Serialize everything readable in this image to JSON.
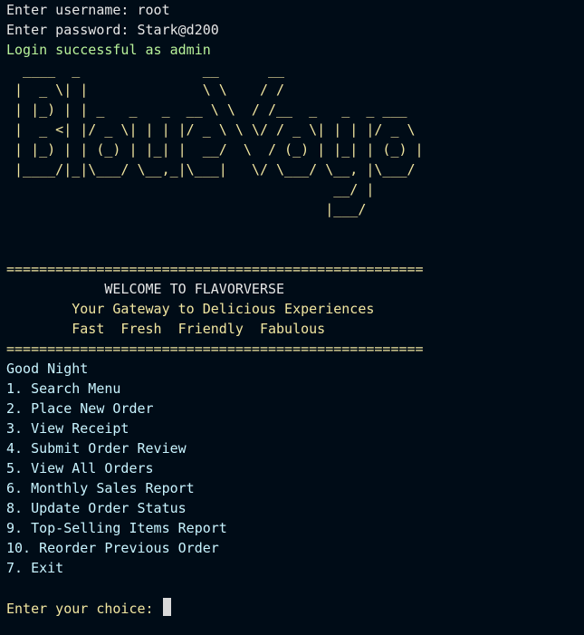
{
  "login": {
    "username_prompt": "Enter username: root",
    "password_prompt": "Enter password: Stark@d200",
    "success_message": "Login successful as admin"
  },
  "banner": {
    "art_lines": [
      "  ____  _               __      __",
      " |  _ \\| |              \\ \\    / /",
      " | |_) | | _   _   _  __ \\ \\  / /__  _   _  _ ___",
      " |  _ <| |/ _ \\| | | |/ _ \\ \\ \\/ / _ \\| | | |/ _ \\",
      " | |_) | | (_) | |_| |  __/  \\  / (_) | |_| | (_) |",
      " |____/|_|\\___/ \\__,_|\\___|   \\/ \\___/ \\__, |\\___/",
      "                                        __/ |",
      "                                       |___/"
    ]
  },
  "welcome": {
    "separator": "===================================================",
    "title": "            WELCOME TO FLAVORVERSE",
    "tagline": "        Your Gateway to Delicious Experiences",
    "motto": "        Fast  Fresh  Friendly  Fabulous"
  },
  "menu": {
    "greeting": "Good Night",
    "items": [
      "1. Search Menu",
      "2. Place New Order",
      "3. View Receipt",
      "4. Submit Order Review",
      "5. View All Orders",
      "6. Monthly Sales Report",
      "8. Update Order Status",
      "9. Top-Selling Items Report",
      "10. Reorder Previous Order",
      "7. Exit"
    ]
  },
  "prompt": {
    "choice": "Enter your choice: "
  },
  "colors": {
    "background": "#000c17",
    "prompt_text": "#e6e6e6",
    "success_text": "#b8f29a",
    "banner_text": "#f1e6a0",
    "menu_text": "#c8f4ff",
    "cursor": "#d9d9d9"
  }
}
